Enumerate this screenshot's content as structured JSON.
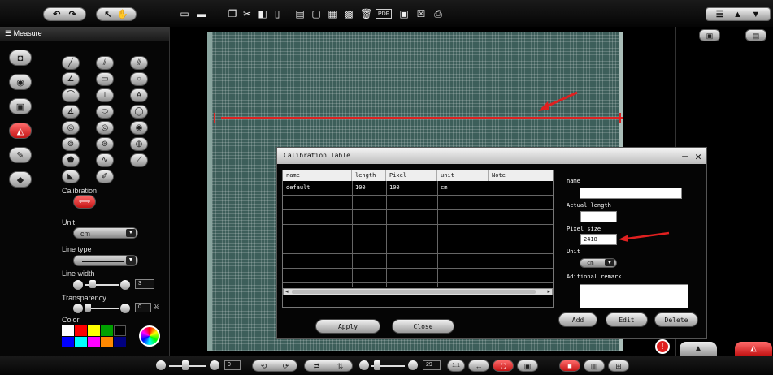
{
  "topbar": {
    "undo_redo": [
      "↶",
      "↷"
    ],
    "pointer_tools": [
      "↖",
      "✋"
    ],
    "icons": [
      "capture-icon",
      "scan-icon",
      "copy-icon",
      "cut-icon",
      "paste-icon",
      "page-icon",
      "window-icon",
      "screen-icon",
      "save-icon",
      "save-as-icon",
      "delete-icon",
      "pdf-icon",
      "close-image-icon",
      "print-icon"
    ],
    "pdf_label": "PDF",
    "right_icons": [
      "list-view-icon",
      "image-view-icon",
      "filter-icon"
    ]
  },
  "left_panel": {
    "header": "Measure",
    "calibration_label": "Calibration",
    "unit_label": "Unit",
    "unit_value": "cm",
    "line_type_label": "Line type",
    "line_width_label": "Line width",
    "line_width_value": "3",
    "transparency_label": "Transparency",
    "transparency_value": "0",
    "transparency_suffix": "%",
    "color_label": "Color",
    "colors": [
      "#ffffff",
      "#ff0000",
      "#ffff00",
      "#00a000",
      "#000000",
      "#0000ff",
      "#00ffff",
      "#ff00ff",
      "#ff8800",
      "#000080"
    ]
  },
  "right_panel": {
    "icons": [
      "window-icon",
      "fit-icon"
    ]
  },
  "dialog": {
    "title": "Calibration Table",
    "minimize": "—",
    "close": "✕",
    "columns": [
      "name",
      "length",
      "Pixel",
      "unit",
      "Note"
    ],
    "rows": [
      {
        "name": "default",
        "length": "100",
        "pixel": "100",
        "unit": "cm",
        "note": ""
      }
    ],
    "apply_label": "Apply",
    "close_label": "Close",
    "fields": {
      "name_label": "name",
      "name_value": "",
      "actual_length_label": "Actual length",
      "actual_length_value": "",
      "pixel_size_label": "Pixel size",
      "pixel_size_value": "2418",
      "unit_label": "Unit",
      "unit_value": "cm",
      "remark_label": "Aditional remark",
      "remark_value": ""
    },
    "add_label": "Add",
    "edit_label": "Edit",
    "delete_label": "Delete"
  },
  "bottombar": {
    "zoom_value": "0",
    "rotate_labels": [
      "⟲",
      "⟳"
    ],
    "flip_labels": [
      "⇄",
      "⇅"
    ],
    "frame_value": "29",
    "view_labels": [
      "1:1",
      "↔",
      "⛶",
      "▣"
    ],
    "layout_labels": [
      "■",
      "▥",
      "⊞"
    ]
  },
  "colors": {
    "accent_red": "#d41c1c",
    "sample_teal": "#3d5e5a"
  }
}
